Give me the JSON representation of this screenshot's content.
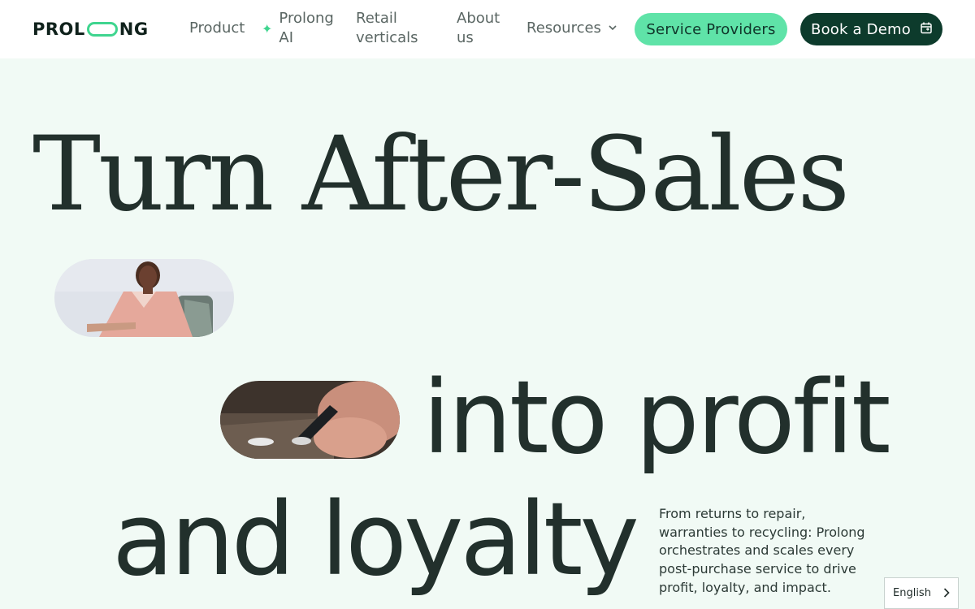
{
  "header": {
    "logo_text_left": "PROL",
    "logo_text_right": "NG",
    "nav": {
      "product": "Product",
      "ai": "Prolong AI",
      "retail": "Retail verticals",
      "about": "About us",
      "resources": "Resources"
    },
    "service_providers": "Service Providers",
    "book_demo": "Book a Demo",
    "icons": {
      "ai": "sparkle-icon",
      "resources": "chevron-down-icon",
      "demo": "calendar-icon"
    }
  },
  "hero": {
    "line1": "Turn After-Sales",
    "line2": "into profit",
    "line3": "and loyalty",
    "description": "From returns to repair, warranties to recycling: Prolong orchestrates and scales every post-purchase service to drive profit, loyalty, and impact."
  },
  "language": {
    "selected": "English"
  },
  "colors": {
    "background": "#f1faf5",
    "accent_green": "#5fe3a8",
    "dark_green": "#0d3b2c",
    "text": "#22302c"
  }
}
